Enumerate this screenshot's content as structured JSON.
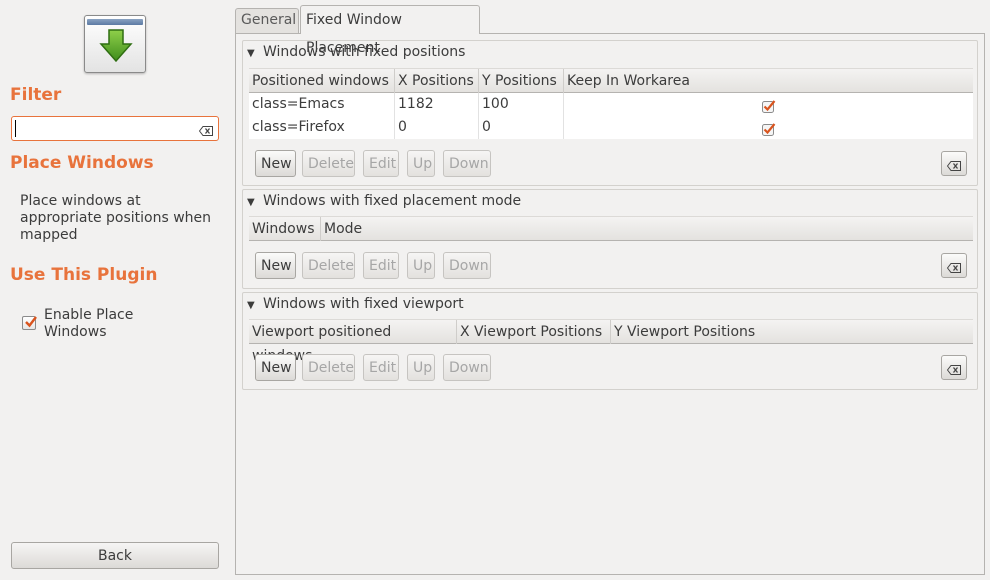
{
  "sidebar": {
    "plugin_icon": "download-arrow-icon",
    "filter_heading": "Filter",
    "filter_value": "",
    "plugin_title": "Place Windows",
    "description": "Place windows at appropriate positions when mapped",
    "use_heading": "Use This Plugin",
    "enable_label": "Enable Place Windows",
    "enable_checked": true,
    "back_label": "Back"
  },
  "tabs": [
    {
      "label": "General",
      "active": false
    },
    {
      "label": "Fixed Window Placement",
      "active": true
    }
  ],
  "groups": {
    "positions": {
      "title": "Windows with fixed positions",
      "columns": [
        "Positioned windows",
        "X Positions",
        "Y Positions",
        "Keep In Workarea"
      ],
      "rows": [
        {
          "window": "class=Emacs",
          "x": "1182",
          "y": "100",
          "keep_in_workarea": true
        },
        {
          "window": "class=Firefox",
          "x": "0",
          "y": "0",
          "keep_in_workarea": true
        }
      ]
    },
    "mode": {
      "title": "Windows with fixed placement mode",
      "columns": [
        "Windows",
        "Mode"
      ]
    },
    "viewport": {
      "title": "Windows with fixed viewport",
      "columns": [
        "Viewport positioned windows",
        "X Viewport Positions",
        "Y Viewport Positions"
      ]
    }
  },
  "buttons": {
    "new": "New",
    "delete": "Delete",
    "edit": "Edit",
    "up": "Up",
    "down": "Down"
  },
  "colors": {
    "accent": "#e8733c",
    "check": "#d9541e"
  }
}
